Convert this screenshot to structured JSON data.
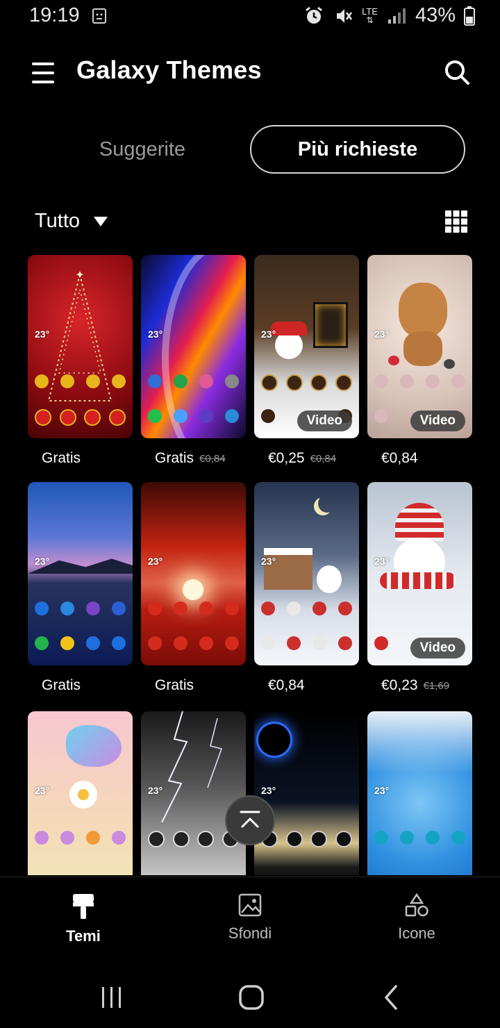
{
  "status_bar": {
    "time": "19:19",
    "battery_percent": "43%",
    "network": "LTE",
    "icons": [
      "screenshot-notification-icon",
      "alarm-icon",
      "mute-icon",
      "lte-signal-icon",
      "battery-icon"
    ]
  },
  "app_bar": {
    "title": "Galaxy Themes",
    "menu_icon": "hamburger-menu-icon",
    "search_icon": "search-icon"
  },
  "tabs": [
    {
      "label": "Suggerite",
      "selected": false
    },
    {
      "label": "Più richieste",
      "selected": true
    }
  ],
  "filter": {
    "label": "Tutto",
    "icon": "dropdown-caret-icon"
  },
  "view_toggle_icon": "grid-view-icon",
  "themes": [
    {
      "price": "Gratis",
      "old_price": "",
      "badge": "",
      "weather": "23°"
    },
    {
      "price": "Gratis",
      "old_price": "€0,84",
      "badge": "",
      "weather": "23°"
    },
    {
      "price": "€0,25",
      "old_price": "€0,84",
      "badge": "Video",
      "weather": "23°"
    },
    {
      "price": "€0,84",
      "old_price": "",
      "badge": "Video",
      "weather": "23°"
    },
    {
      "price": "Gratis",
      "old_price": "",
      "badge": "",
      "weather": "23°"
    },
    {
      "price": "Gratis",
      "old_price": "",
      "badge": "",
      "weather": "23°"
    },
    {
      "price": "€0,84",
      "old_price": "",
      "badge": "",
      "weather": "23°"
    },
    {
      "price": "€0,23",
      "old_price": "€1,69",
      "badge": "Video",
      "weather": "23°"
    },
    {
      "price": "",
      "old_price": "",
      "badge": "",
      "weather": "23°"
    },
    {
      "price": "",
      "old_price": "",
      "badge": "",
      "weather": "23°"
    },
    {
      "price": "",
      "old_price": "",
      "badge": "",
      "weather": "23°"
    },
    {
      "price": "",
      "old_price": "",
      "badge": "",
      "weather": "23°"
    }
  ],
  "scroll_top_icon": "scroll-to-top-icon",
  "bottom_nav": [
    {
      "label": "Temi",
      "icon": "paint-roller-icon",
      "active": true
    },
    {
      "label": "Sfondi",
      "icon": "image-icon",
      "active": false
    },
    {
      "label": "Icone",
      "icon": "shapes-icon",
      "active": false
    }
  ],
  "system_nav": [
    "recents-icon",
    "home-icon",
    "back-icon"
  ]
}
